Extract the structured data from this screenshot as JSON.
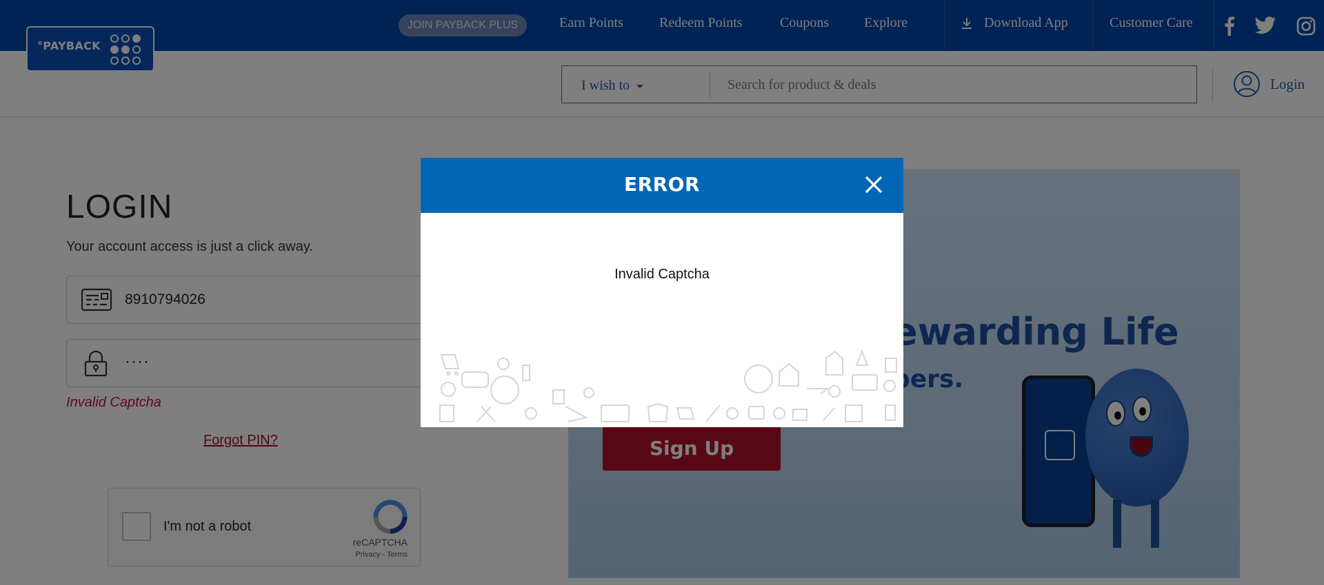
{
  "header": {
    "logo_text": "°PAYBACK",
    "join_plus": "JOIN PAYBACK PLUS",
    "nav": [
      "Earn Points",
      "Redeem Points",
      "Coupons",
      "Explore"
    ],
    "download_app": "Download App",
    "customer_care": "Customer Care"
  },
  "search": {
    "i_wish": "I wish to",
    "placeholder": "Search for product & deals",
    "login": "Login"
  },
  "login_form": {
    "title": "LOGIN",
    "subtitle": "Your account access is just a click away.",
    "card_number": "8910794026",
    "pin_masked": "····",
    "error": "Invalid Captcha",
    "forgot": "Forgot PIN?",
    "recaptcha_label": "I'm not a robot",
    "recaptcha_brand": "reCAPTCHA",
    "recaptcha_privacy": "Privacy",
    "recaptcha_sep": "-",
    "recaptcha_terms": "Terms"
  },
  "banner": {
    "headline": "ewarding Life",
    "subline": "bers.",
    "signup": "Sign Up"
  },
  "modal": {
    "title": "ERROR",
    "message": "Invalid Captcha"
  },
  "colors": {
    "topbar": "#0046aa",
    "modal_header": "#0266b5",
    "signup": "#b0102b",
    "error_text": "#c4122f"
  }
}
